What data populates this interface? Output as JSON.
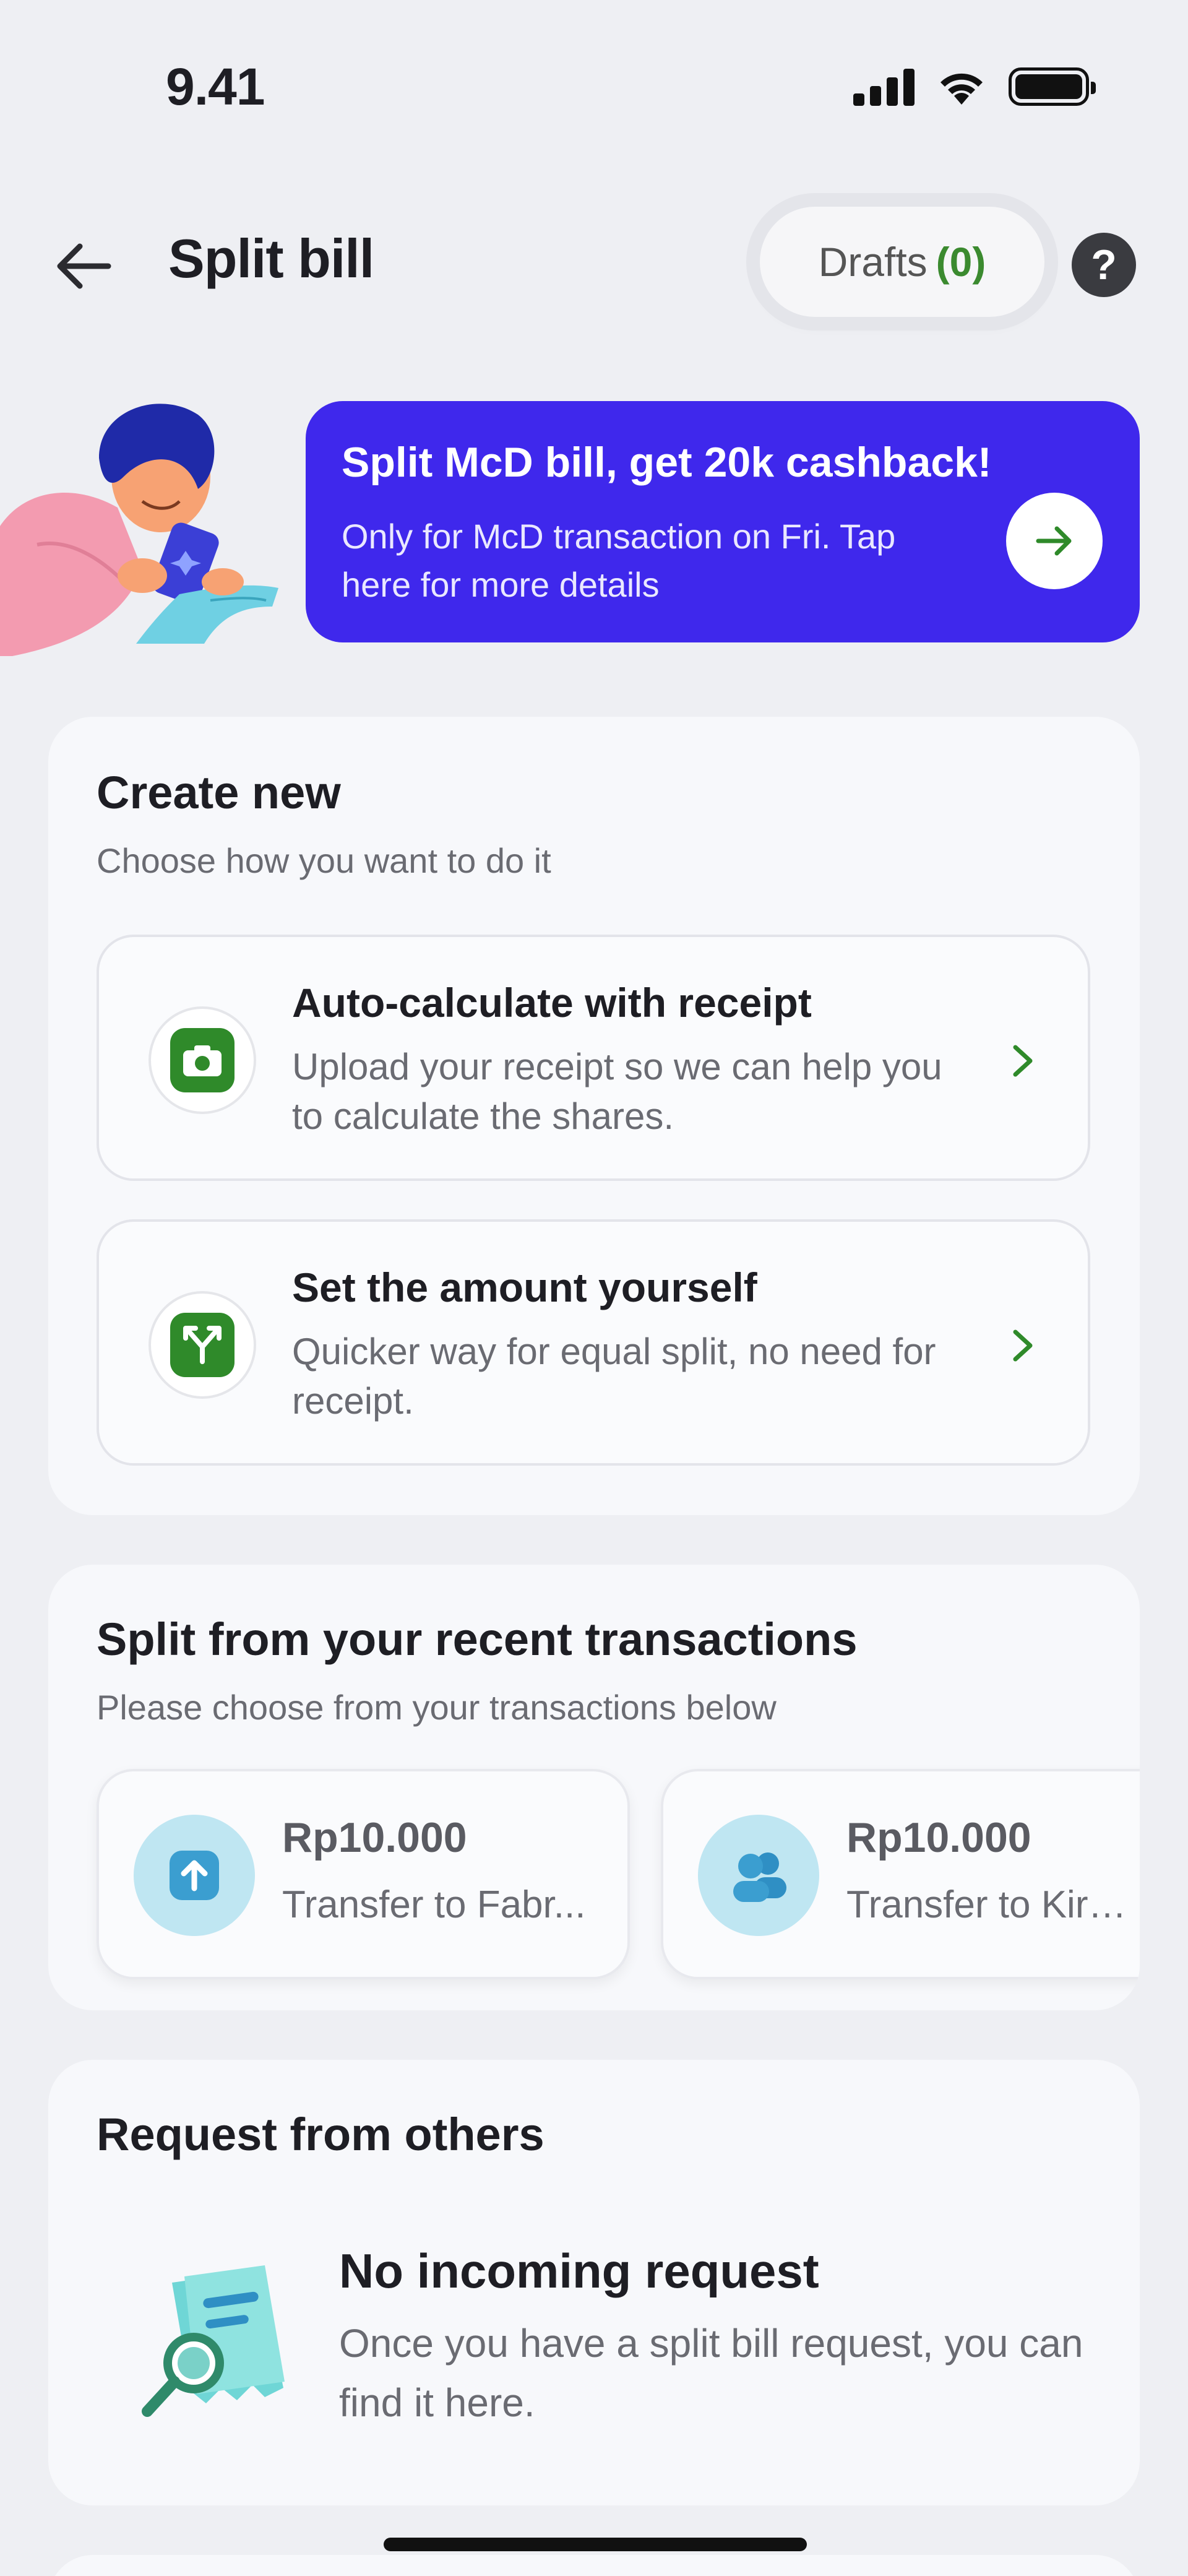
{
  "status_bar": {
    "time": "9.41"
  },
  "header": {
    "title": "Split bill",
    "drafts_label": "Drafts",
    "drafts_count": "(0)",
    "help_label": "?"
  },
  "promo": {
    "title": "Split McD bill, get 20k cashback!",
    "description": "Only for McD transaction on Fri. Tap here for more details"
  },
  "create_new": {
    "title": "Create new",
    "subtitle": "Choose how you want to do it",
    "options": [
      {
        "title": "Auto-calculate with receipt",
        "description": "Upload your receipt so we can help you to calculate the shares.",
        "icon": "camera-icon"
      },
      {
        "title": "Set the amount yourself",
        "description": "Quicker way for equal split, no need for receipt.",
        "icon": "split-icon"
      }
    ]
  },
  "recent": {
    "title": "Split from your recent transactions",
    "subtitle": "Please choose from your transactions below",
    "transactions": [
      {
        "amount": "Rp10.000",
        "description": "Transfer to Fabr...",
        "icon": "transfer-up-icon"
      },
      {
        "amount": "Rp10.000",
        "description": "Transfer to Kira...",
        "icon": "group-icon"
      }
    ]
  },
  "request": {
    "title": "Request from others",
    "empty_title": "No incoming request",
    "empty_description": "Once you have a split bill request, you can find it here."
  },
  "colors": {
    "accent_green": "#2f8a2a",
    "promo_blue": "#3f28ec",
    "background": "#eeeff3"
  }
}
